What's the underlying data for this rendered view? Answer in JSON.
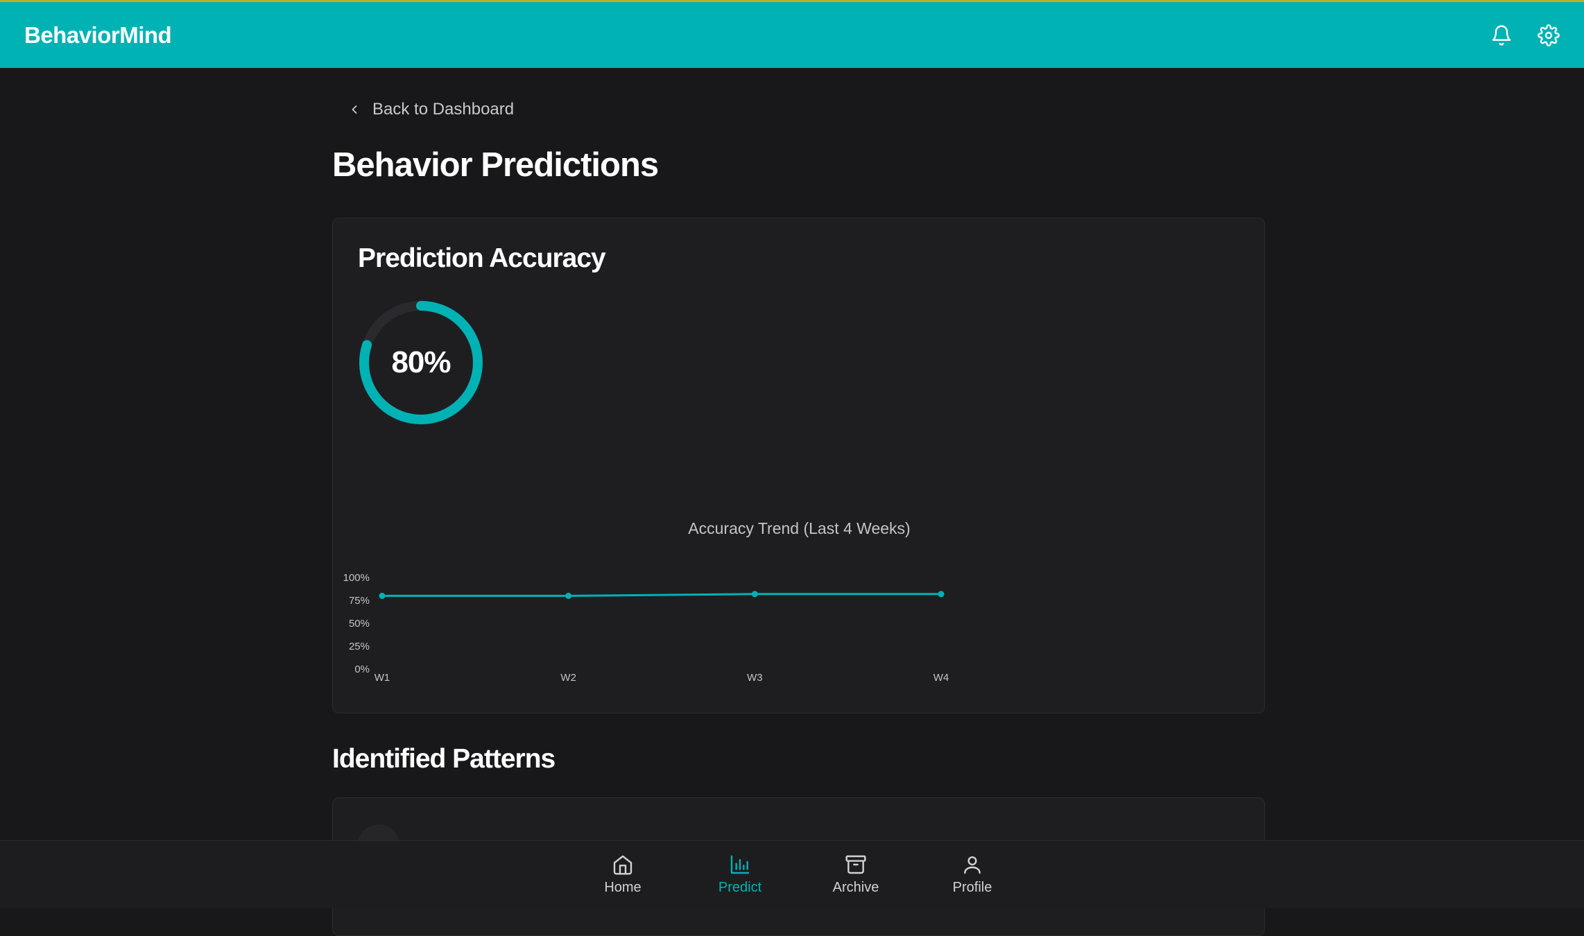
{
  "app": {
    "brand": "BehaviorMind"
  },
  "header": {
    "icons": [
      "bell-icon",
      "gear-icon"
    ]
  },
  "nav": {
    "back_label": "Back to Dashboard"
  },
  "page": {
    "title": "Behavior Predictions"
  },
  "accuracy_card": {
    "title": "Prediction Accuracy",
    "gauge_value": 0.8,
    "gauge_text": "80%",
    "trend_title": "Accuracy Trend (Last 4 Weeks)"
  },
  "patterns": {
    "title": "Identified Patterns"
  },
  "bottom_nav": {
    "items": [
      {
        "label": "Home",
        "icon": "home-icon"
      },
      {
        "label": "Predict",
        "icon": "bar-chart-icon",
        "active": true
      },
      {
        "label": "Archive",
        "icon": "archive-box-icon"
      },
      {
        "label": "Profile",
        "icon": "user-icon"
      }
    ]
  },
  "colors": {
    "accent": "#00b2b4",
    "background": "#18181a",
    "card": "#1e1e21"
  },
  "chart_data": {
    "type": "line",
    "title": "Accuracy Trend (Last 4 Weeks)",
    "categories": [
      "W1",
      "W2",
      "W3",
      "W4"
    ],
    "values": [
      80,
      80,
      82,
      82
    ],
    "ylim": [
      0,
      100
    ],
    "y_ticks": [
      "0%",
      "25%",
      "50%",
      "75%",
      "100%"
    ],
    "grid": false,
    "color": "#00b2b4"
  }
}
